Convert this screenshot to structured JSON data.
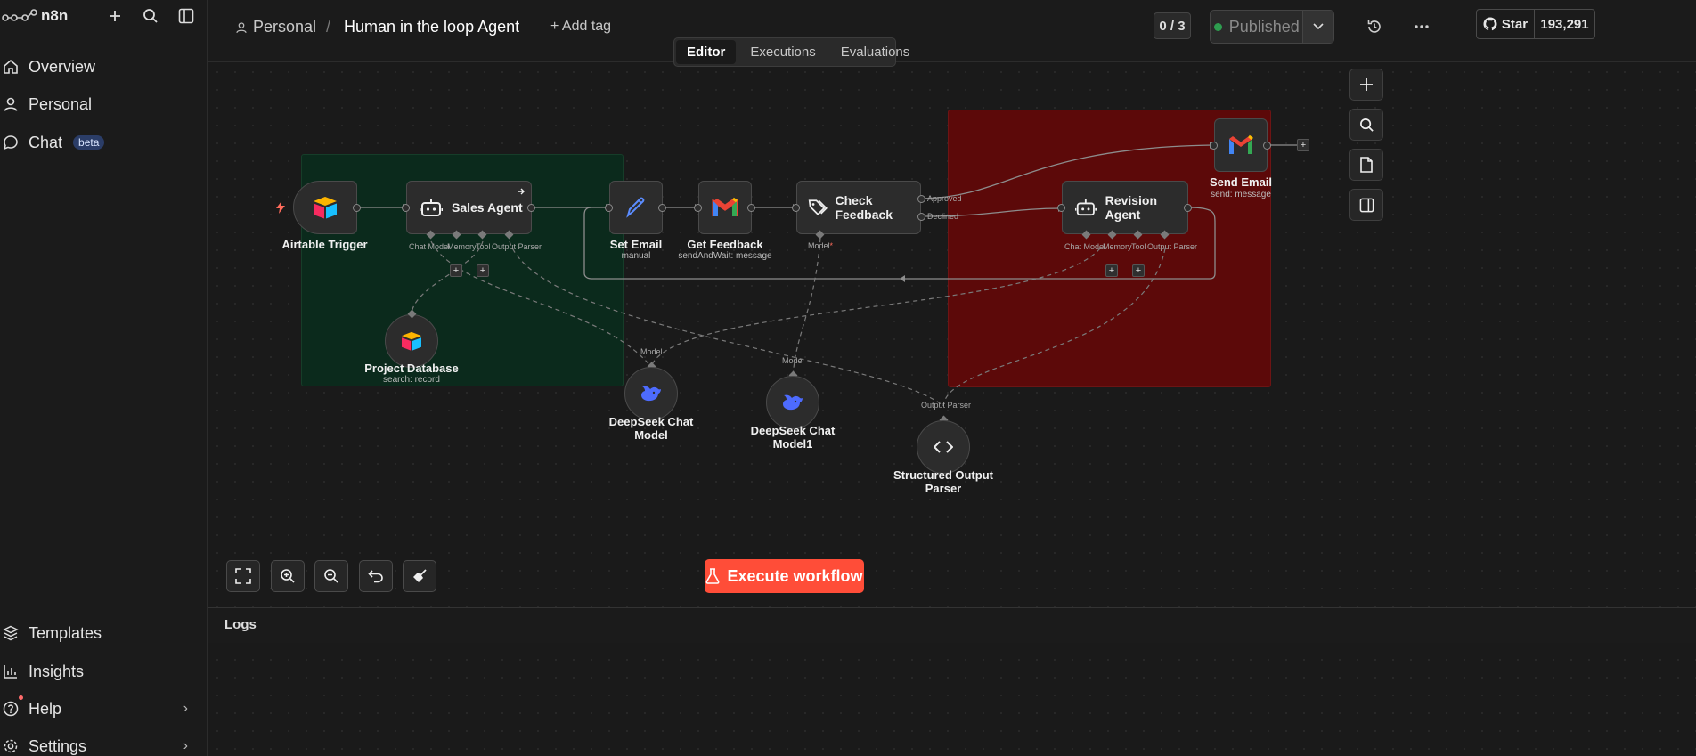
{
  "app": {
    "brand": "n8n"
  },
  "sidebar": {
    "items": [
      {
        "label": "Overview"
      },
      {
        "label": "Personal"
      },
      {
        "label": "Chat",
        "badge": "beta"
      }
    ],
    "bottom": [
      {
        "label": "Templates"
      },
      {
        "label": "Insights"
      },
      {
        "label": "Help"
      },
      {
        "label": "Settings"
      }
    ]
  },
  "header": {
    "project": "Personal",
    "separator": "/",
    "workflow_name": "Human in the loop Agent",
    "add_tag": "+ Add tag",
    "count": "0 / 3",
    "status": "Published",
    "github_star": "Star",
    "github_count": "193,291",
    "tabs": [
      "Editor",
      "Executions",
      "Evaluations"
    ],
    "active_tab": "Editor"
  },
  "colors": {
    "green_sticky": "#0b2a1c",
    "red_sticky": "#5c0909",
    "execute": "#ff4d38"
  },
  "nodes": {
    "airtable_trigger": {
      "title": "Airtable Trigger"
    },
    "sales_agent": {
      "title": "Sales Agent",
      "ports": [
        "Chat Model",
        "Memory",
        "Tool",
        "Output Parser"
      ]
    },
    "set_email": {
      "title": "Set Email",
      "sub": "manual"
    },
    "get_feedback": {
      "title": "Get Feedback",
      "sub": "sendAndWait: message"
    },
    "check_feedback": {
      "title": "Check Feedback",
      "outputs": [
        "Approved",
        "Declined"
      ],
      "port": "Model"
    },
    "revision_agent": {
      "title": "Revision Agent",
      "ports": [
        "Chat Model",
        "Memory",
        "Tool",
        "Output Parser"
      ]
    },
    "send_email": {
      "title": "Send Email",
      "sub": "send: message"
    },
    "project_database": {
      "title": "Project Database",
      "sub": "search: record"
    },
    "deepseek_1": {
      "title": "DeepSeek Chat Model",
      "port": "Model"
    },
    "deepseek_2": {
      "title": "DeepSeek Chat Model1",
      "port": "Model"
    },
    "structured_parser": {
      "title": "Structured Output Parser",
      "port": "Output Parser"
    }
  },
  "canvas": {
    "execute_label": "Execute workflow",
    "logs_label": "Logs"
  }
}
